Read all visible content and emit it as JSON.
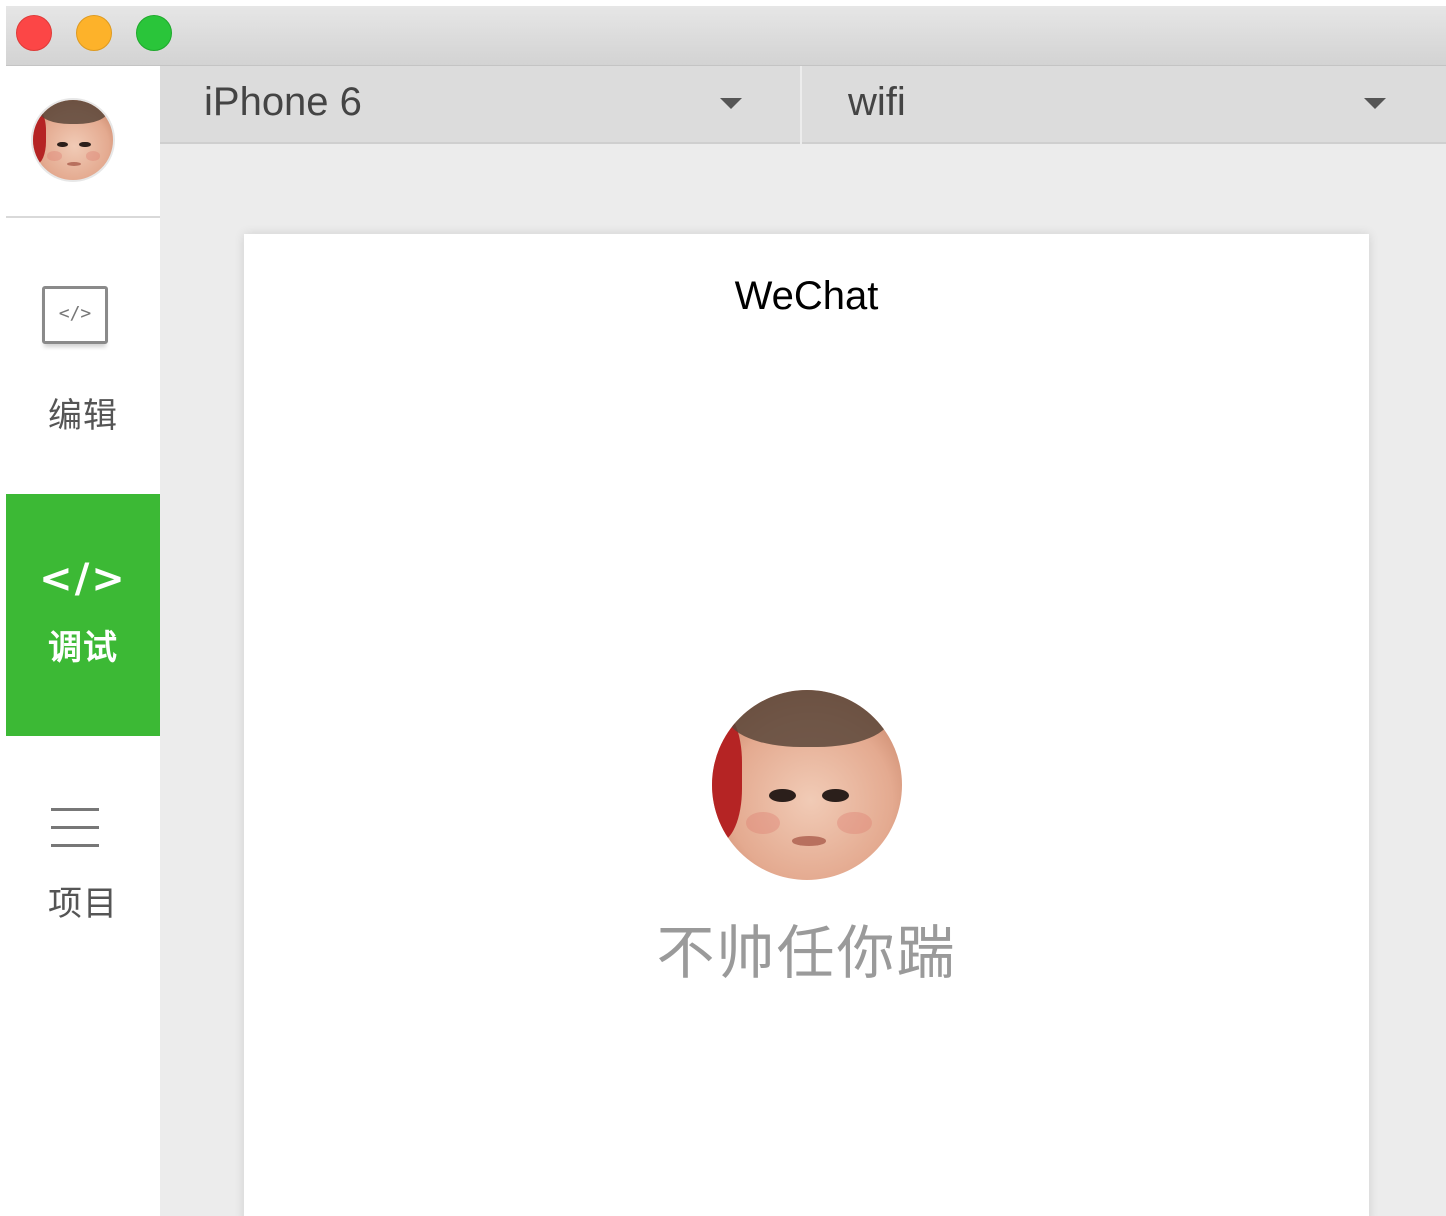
{
  "titlebar": {
    "buttons": [
      "close",
      "minimize",
      "maximize"
    ]
  },
  "sidebar": {
    "avatar": "baby-face-avatar",
    "items": [
      {
        "label": "编辑",
        "icon": "code-editor-icon",
        "active": false
      },
      {
        "label": "调试",
        "icon": "code-brackets-icon",
        "glyph": "</>",
        "active": true
      },
      {
        "label": "项目",
        "icon": "menu-lines-icon",
        "active": false
      }
    ],
    "editor_glyph": "</>"
  },
  "toolbar": {
    "device": "iPhone 6",
    "network": "wifi"
  },
  "preview": {
    "nav_title": "WeChat",
    "motto": "不帅任你踹"
  },
  "colors": {
    "accent_green": "#3cb935",
    "close": "#fc4646",
    "minimize": "#fdb22a",
    "maximize": "#2ac53a"
  }
}
